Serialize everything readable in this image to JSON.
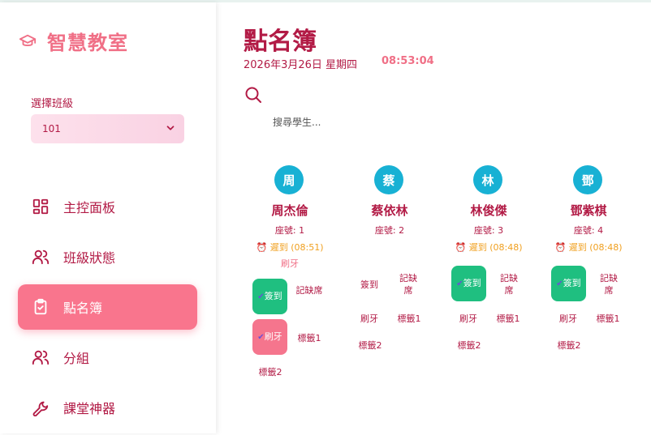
{
  "app": {
    "title": "智慧教室"
  },
  "sidebar": {
    "class_label": "選擇班級",
    "class_value": "101",
    "items": [
      {
        "label": "主控面板",
        "icon": "dashboard-icon",
        "active": false
      },
      {
        "label": "班級狀態",
        "icon": "users-icon",
        "active": false
      },
      {
        "label": "點名簿",
        "icon": "clipboard-check-icon",
        "active": true
      },
      {
        "label": "分組",
        "icon": "group-icon",
        "active": false
      },
      {
        "label": "課堂神器",
        "icon": "wrench-icon",
        "active": false
      }
    ]
  },
  "header": {
    "title": "點名簿",
    "date": "2026年3月26日 星期四",
    "time": "08:53:04"
  },
  "search": {
    "placeholder": "搜尋學生..."
  },
  "students": [
    {
      "avatar": "周",
      "name": "周杰倫",
      "seat": "座號: 1",
      "late": "遲到 (08:51)",
      "note": "刷牙",
      "buttons": {
        "checkin": "簽到",
        "absent": "記缺席",
        "brush": "刷牙",
        "tag1": "標籤1",
        "tag2": "標籤2"
      }
    },
    {
      "avatar": "蔡",
      "name": "蔡依林",
      "seat": "座號: 2",
      "late": "",
      "note": "",
      "buttons": {
        "checkin": "簽到",
        "absent": "記缺席",
        "brush": "刷牙",
        "tag1": "標籤1",
        "tag2": "標籤2"
      }
    },
    {
      "avatar": "林",
      "name": "林俊傑",
      "seat": "座號: 3",
      "late": "遲到 (08:48)",
      "note": "",
      "buttons": {
        "checkin": "簽到",
        "absent": "記缺席",
        "brush": "刷牙",
        "tag1": "標籤1",
        "tag2": "標籤2"
      }
    },
    {
      "avatar": "鄧",
      "name": "鄧紫棋",
      "seat": "座號: 4",
      "late": "遲到 (08:48)",
      "note": "",
      "buttons": {
        "checkin": "簽到",
        "absent": "記缺席",
        "brush": "刷牙",
        "tag1": "標籤1",
        "tag2": "標籤2"
      }
    }
  ],
  "colors": {
    "accent": "#b21a45",
    "pink": "#f9758d",
    "avatar": "#18b1d4",
    "checked": "#1fbf80",
    "late": "#f0a020"
  }
}
